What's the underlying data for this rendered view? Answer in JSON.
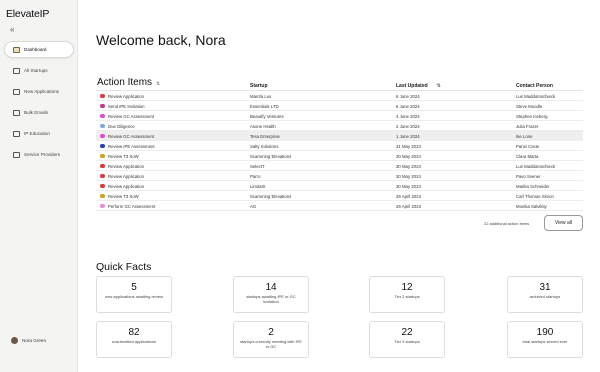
{
  "app": {
    "logo": "ElevateIP",
    "collapse_icon": "«"
  },
  "sidebar": {
    "items": [
      {
        "label": "Dashboard",
        "icon": "dashboard-icon",
        "active": true
      },
      {
        "label": "All Startups",
        "icon": "startups-icon"
      },
      {
        "label": "New Applications",
        "icon": "applications-icon"
      },
      {
        "label": "Bulk Emails",
        "icon": "email-icon"
      },
      {
        "label": "IP Education",
        "icon": "education-icon"
      },
      {
        "label": "Service Providers",
        "icon": "providers-icon"
      }
    ],
    "user": {
      "name": "Nora Green"
    }
  },
  "main": {
    "welcome": "Welcome back, Nora",
    "action_items": {
      "title": "Action Items",
      "sort_icon": "⇅",
      "columns": {
        "startup": "Startup",
        "last_updated": "Last Updated",
        "contact": "Contact Person"
      },
      "rows": [
        {
          "action": "Review Application",
          "color": "#d93a3a",
          "startup": "Mamfa Lux",
          "date": "6 June 2024",
          "contact": "Lus Maddotoschieck"
        },
        {
          "action": "Send IPE Invitation",
          "color": "#c23a8c",
          "startup": "Essentials LTD",
          "date": "6 June 2024",
          "contact": "Steve Moodle"
        },
        {
          "action": "Review GC Assessment",
          "color": "#d94fcf",
          "startup": "Beautify Ventures",
          "date": "4 June 2024",
          "contact": "Stephen Iceberg"
        },
        {
          "action": "Due Diligence",
          "color": "#7fa8d6",
          "startup": "Asone Health",
          "date": "2 June 2024",
          "contact": "Julia Frazer"
        },
        {
          "action": "Review GC Assessment",
          "color": "#d94fcf",
          "startup": "Tesa Enterprise",
          "date": "1 June 2024",
          "contact": "Ike Lone",
          "highlight": true
        },
        {
          "action": "Review IPE Assessment",
          "color": "#2a3fb0",
          "startup": "Salty Solutions",
          "date": "31 May 2024",
          "contact": "Pansi Coste"
        },
        {
          "action": "Review T3 SoW",
          "color": "#c9a228",
          "startup": "Scamming Elevations",
          "date": "30 May 2024",
          "contact": "Clara Marta"
        },
        {
          "action": "Review Application",
          "color": "#d93a3a",
          "startup": "SelectT",
          "date": "30 May 2024",
          "contact": "Lus Maddotoschieck"
        },
        {
          "action": "Review Application",
          "color": "#d93a3a",
          "startup": "Parro",
          "date": "30 May 2024",
          "contact": "Pavo Svener"
        },
        {
          "action": "Review Application",
          "color": "#d93a3a",
          "startup": "LimitaIX",
          "date": "30 May 2024",
          "contact": "Marika Schneider"
        },
        {
          "action": "Review T3 SoW",
          "color": "#c9a228",
          "startup": "Scamming Elevations",
          "date": "29 April 2024",
          "contact": "Carl Thomas Simon"
        },
        {
          "action": "Perform GC Assessment",
          "color": "#e58fd8",
          "startup": "AG",
          "date": "29 April 2024",
          "contact": "Monika Salvikity"
        }
      ],
      "more_text": "22 additional action items",
      "view_all_label": "View all"
    },
    "quick_facts": {
      "title": "Quick Facts",
      "cards": [
        {
          "value": "5",
          "label": "new applications awaiting review"
        },
        {
          "value": "14",
          "label": "startups awaiting IPE or GC invitation"
        },
        {
          "value": "12",
          "label": "Tier 2 startups"
        },
        {
          "value": "31",
          "label": "archived startups"
        },
        {
          "value": "82",
          "label": "unsubmitted applications"
        },
        {
          "value": "2",
          "label": "startups currently meeting with IPE or GC"
        },
        {
          "value": "22",
          "label": "Tier 3 startups"
        },
        {
          "value": "190",
          "label": "total startups served ever"
        }
      ]
    }
  }
}
